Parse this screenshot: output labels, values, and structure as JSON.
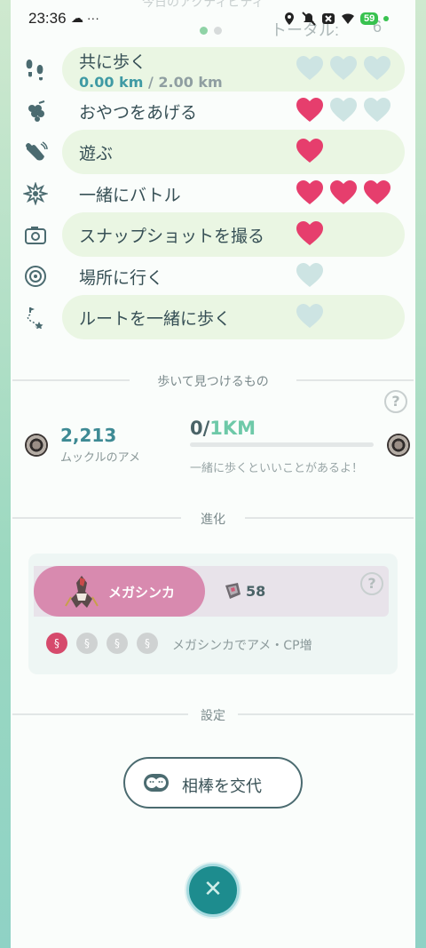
{
  "status_bar": {
    "time": "23:36",
    "left_icons": "☁ ···",
    "battery": "59"
  },
  "header": {
    "title_partial": "今日のアクティビティ",
    "total_label": "トータル:",
    "total_value": "6"
  },
  "activities": [
    {
      "label": "共に歩く",
      "progress": "0.00 km",
      "goal": "/ 2.00 km",
      "filled": 0,
      "max": 3,
      "highlighted": true,
      "icon": "footprints-icon"
    },
    {
      "label": "おやつをあげる",
      "filled": 1,
      "max": 3,
      "highlighted": false,
      "icon": "berry-icon"
    },
    {
      "label": "遊ぶ",
      "filled": 1,
      "max": 1,
      "highlighted": true,
      "icon": "hand-wave-icon"
    },
    {
      "label": "一緒にバトル",
      "filled": 3,
      "max": 3,
      "highlighted": false,
      "icon": "battle-burst-icon"
    },
    {
      "label": "スナップショットを撮る",
      "filled": 1,
      "max": 1,
      "highlighted": true,
      "icon": "camera-icon"
    },
    {
      "label": "場所に行く",
      "filled": 0,
      "max": 1,
      "highlighted": false,
      "icon": "pokestop-icon"
    },
    {
      "label": "ルートを一緒に歩く",
      "filled": 0,
      "max": 1,
      "highlighted": true,
      "icon": "route-icon"
    }
  ],
  "walk_section": {
    "title": "歩いて見つけるもの",
    "candy_count": "2,213",
    "candy_name": "ムックルのアメ",
    "km_current": "0",
    "km_separator": "/",
    "km_target": "1KM",
    "note": "一緒に歩くといいことがあるよ！"
  },
  "evolution_section": {
    "title": "進化",
    "mega_button": "メガシンカ",
    "mega_energy": "58",
    "note": "メガシンカでアメ・CP増",
    "mega_level": 1,
    "mega_level_max": 4
  },
  "settings_section": {
    "title": "設定",
    "swap_button": "相棒を交代"
  },
  "colors": {
    "heart_filled": "#e63e6d",
    "heart_empty": "#cde4e3",
    "accent_teal": "#3f9aa4",
    "pill_bg": "#eaf6e3",
    "mega_pink": "#d88aaf"
  },
  "help_icon": "?",
  "close_icon": "✕"
}
